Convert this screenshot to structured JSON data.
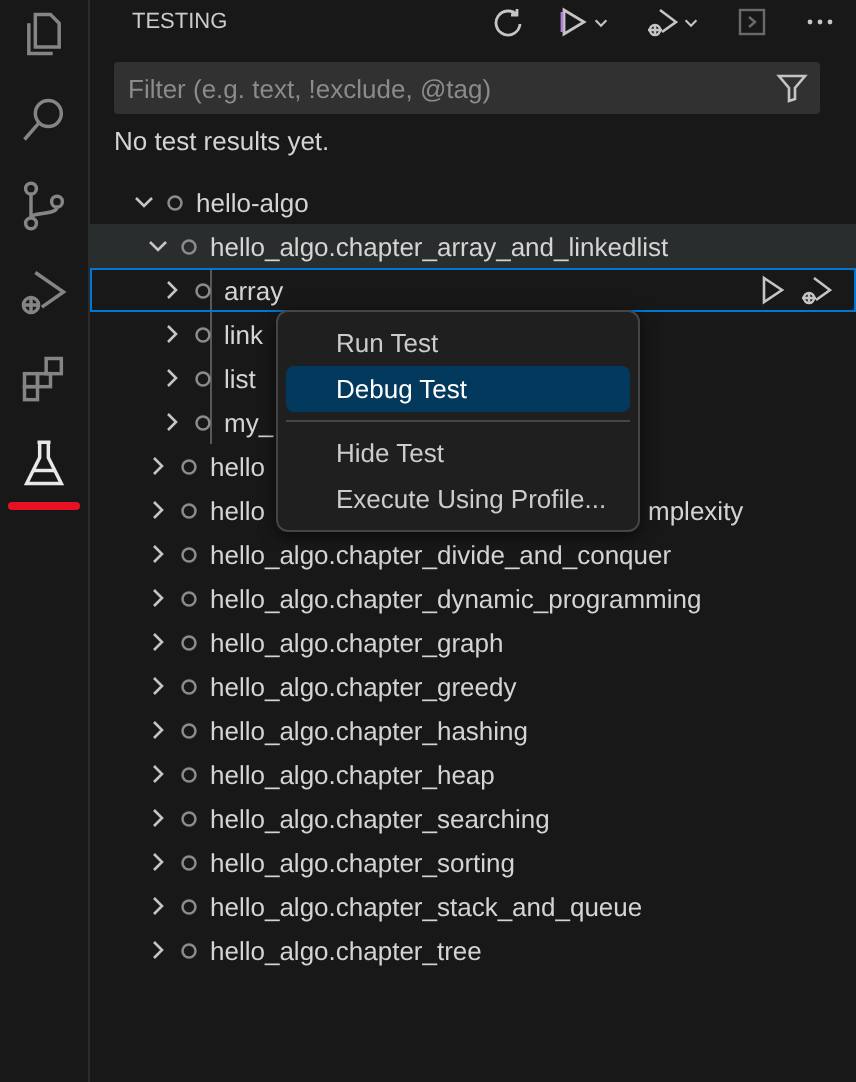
{
  "activity_bar": {
    "items": [
      {
        "kind": "files",
        "selected": false
      },
      {
        "kind": "search",
        "selected": false
      },
      {
        "kind": "source-control",
        "selected": false
      },
      {
        "kind": "run-debug",
        "selected": false
      },
      {
        "kind": "extensions",
        "selected": false
      },
      {
        "kind": "testing",
        "selected": true
      }
    ]
  },
  "panel": {
    "title": "TESTING"
  },
  "filter": {
    "placeholder": "Filter (e.g. text, !exclude, @tag)"
  },
  "status": "No test results yet.",
  "tree": [
    {
      "label": "hello-algo",
      "expanded": true,
      "selected": false,
      "hovered": false,
      "children": [
        {
          "label": "hello_algo.chapter_array_and_linkedlist",
          "expanded": true,
          "selected": false,
          "hovered": true,
          "children": [
            {
              "label": "array",
              "expanded": false,
              "selected": true,
              "hovered": false
            },
            {
              "label": "link",
              "expanded": false,
              "selected": false,
              "hovered": false
            },
            {
              "label": "list",
              "expanded": false,
              "selected": false,
              "hovered": false
            },
            {
              "label": "my_",
              "expanded": false,
              "selected": false,
              "hovered": false
            }
          ]
        },
        {
          "label": "hello",
          "expanded": false,
          "selected": false,
          "hovered": false
        },
        {
          "label": "hello",
          "label_tail": "mplexity",
          "expanded": false,
          "selected": false,
          "hovered": false
        },
        {
          "label": "hello_algo.chapter_divide_and_conquer",
          "expanded": false,
          "selected": false,
          "hovered": false
        },
        {
          "label": "hello_algo.chapter_dynamic_programming",
          "expanded": false,
          "selected": false,
          "hovered": false
        },
        {
          "label": "hello_algo.chapter_graph",
          "expanded": false,
          "selected": false,
          "hovered": false
        },
        {
          "label": "hello_algo.chapter_greedy",
          "expanded": false,
          "selected": false,
          "hovered": false
        },
        {
          "label": "hello_algo.chapter_hashing",
          "expanded": false,
          "selected": false,
          "hovered": false
        },
        {
          "label": "hello_algo.chapter_heap",
          "expanded": false,
          "selected": false,
          "hovered": false
        },
        {
          "label": "hello_algo.chapter_searching",
          "expanded": false,
          "selected": false,
          "hovered": false
        },
        {
          "label": "hello_algo.chapter_sorting",
          "expanded": false,
          "selected": false,
          "hovered": false
        },
        {
          "label": "hello_algo.chapter_stack_and_queue",
          "expanded": false,
          "selected": false,
          "hovered": false
        },
        {
          "label": "hello_algo.chapter_tree",
          "expanded": false,
          "selected": false,
          "hovered": false
        }
      ]
    }
  ],
  "context_menu": {
    "items": [
      {
        "kind": "item",
        "label": "Run Test",
        "selected": false
      },
      {
        "kind": "item",
        "label": "Debug Test",
        "selected": true
      },
      {
        "kind": "separator"
      },
      {
        "kind": "item",
        "label": "Hide Test",
        "selected": false
      },
      {
        "kind": "item",
        "label": "Execute Using Profile...",
        "selected": false
      }
    ]
  }
}
